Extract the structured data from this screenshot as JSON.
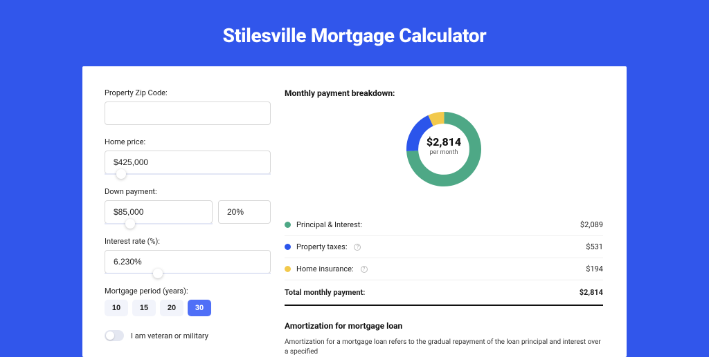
{
  "title": "Stilesville Mortgage Calculator",
  "form": {
    "zip": {
      "label": "Property Zip Code:",
      "value": ""
    },
    "price": {
      "label": "Home price:",
      "value": "$425,000",
      "slider_pos": "7%"
    },
    "down": {
      "label": "Down payment:",
      "value": "$85,000",
      "pct": "20%",
      "slider_pos": "19%"
    },
    "rate": {
      "label": "Interest rate (%):",
      "value": "6.230%",
      "slider_pos": "29%"
    },
    "period": {
      "label": "Mortgage period (years):",
      "options": [
        "10",
        "15",
        "20",
        "30"
      ],
      "active": "30"
    },
    "veteran_label": "I am veteran or military"
  },
  "breakdown": {
    "title": "Monthly payment breakdown:",
    "center_value": "$2,814",
    "center_sub": "per month",
    "rows": [
      {
        "label": "Principal & Interest:",
        "amount": "$2,089",
        "color": "green",
        "info": false
      },
      {
        "label": "Property taxes:",
        "amount": "$531",
        "color": "blue",
        "info": true
      },
      {
        "label": "Home insurance:",
        "amount": "$194",
        "color": "yellow",
        "info": true
      }
    ],
    "total_label": "Total monthly payment:",
    "total_amount": "$2,814"
  },
  "amortization": {
    "title": "Amortization for mortgage loan",
    "text": "Amortization for a mortgage loan refers to the gradual repayment of the loan principal and interest over a specified"
  },
  "chart_data": {
    "type": "pie",
    "title": "Monthly payment breakdown",
    "series": [
      {
        "name": "Principal & Interest",
        "value": 2089,
        "color": "#4ea886"
      },
      {
        "name": "Property taxes",
        "value": 531,
        "color": "#2b55eb"
      },
      {
        "name": "Home insurance",
        "value": 194,
        "color": "#f2c94c"
      }
    ],
    "total": 2814,
    "center_label": "$2,814 per month"
  }
}
